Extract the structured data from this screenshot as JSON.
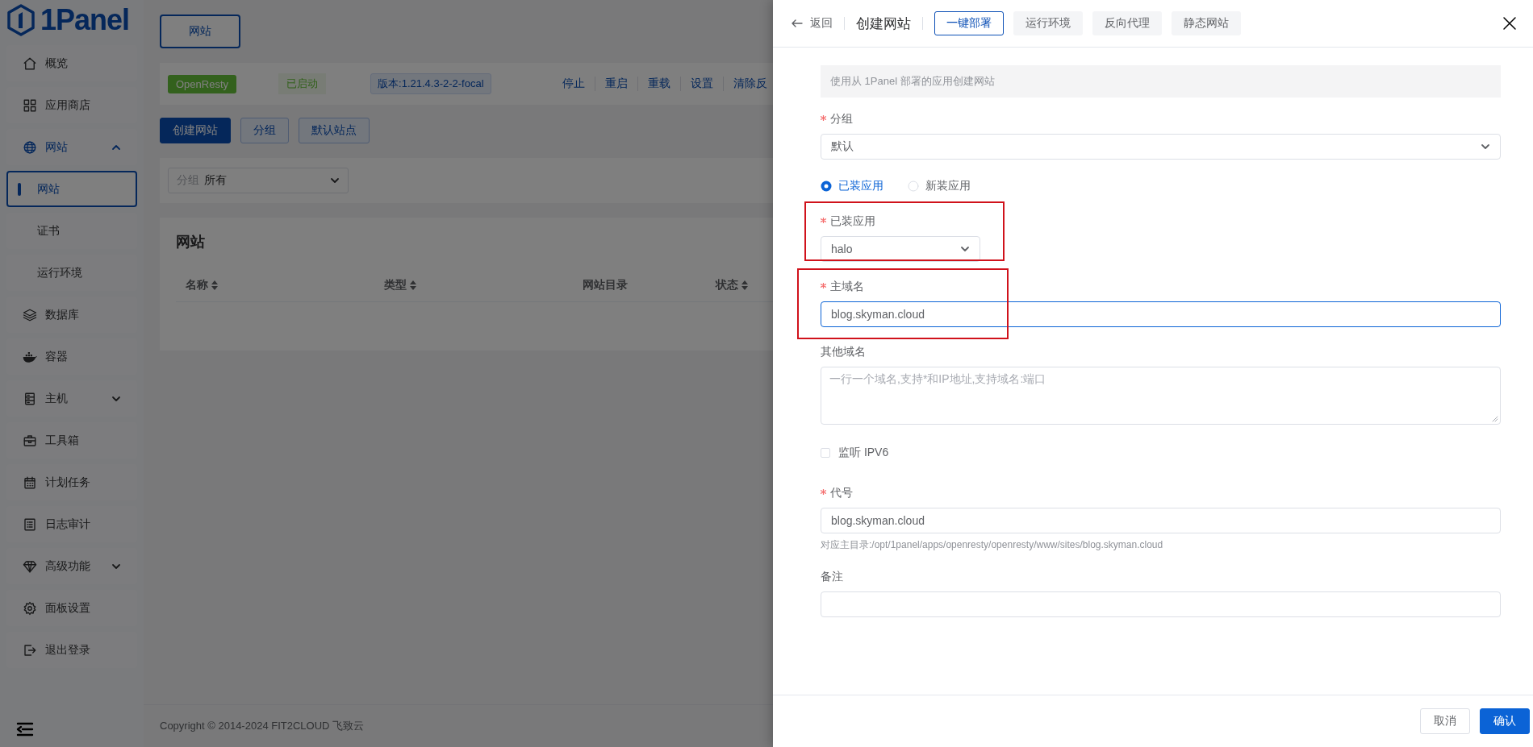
{
  "sidebar": {
    "logo": "1Panel",
    "items": [
      {
        "label": "概览",
        "selected": false
      },
      {
        "label": "应用商店",
        "selected": false
      },
      {
        "label": "网站",
        "selected": false,
        "expanded": true,
        "children": [
          {
            "label": "网站",
            "selected": true
          },
          {
            "label": "证书",
            "selected": false
          },
          {
            "label": "运行环境",
            "selected": false
          }
        ]
      },
      {
        "label": "数据库",
        "selected": false
      },
      {
        "label": "容器",
        "selected": false
      },
      {
        "label": "主机",
        "selected": false,
        "expanded": false
      },
      {
        "label": "工具箱",
        "selected": false
      },
      {
        "label": "计划任务",
        "selected": false
      },
      {
        "label": "日志审计",
        "selected": false
      },
      {
        "label": "高级功能",
        "selected": false,
        "expanded": false
      },
      {
        "label": "面板设置",
        "selected": false
      },
      {
        "label": "退出登录",
        "selected": false
      }
    ]
  },
  "page_tabs": [
    {
      "label": "网站",
      "selected": true
    }
  ],
  "app_status": {
    "app": "OpenResty",
    "state": "已启动",
    "version": "版本:1.21.4.3-2-2-focal",
    "actions": [
      "停止",
      "重启",
      "重载",
      "设置",
      "清除反"
    ]
  },
  "toolbar": [
    {
      "label": "创建网站",
      "primary": true
    },
    {
      "label": "分组",
      "primary": false
    },
    {
      "label": "默认站点",
      "primary": false
    }
  ],
  "filter": {
    "label": "分组",
    "value": "所有"
  },
  "table": {
    "title": "网站",
    "columns": [
      {
        "label": "名称",
        "sortable": true
      },
      {
        "label": "类型",
        "sortable": true
      },
      {
        "label": "网站目录",
        "sortable": false
      },
      {
        "label": "状态",
        "sortable": true
      }
    ]
  },
  "footer": "Copyright © 2014-2024 FIT2CLOUD 飞致云",
  "drawer": {
    "back": "返回",
    "title": "创建网站",
    "tabs": [
      {
        "label": "一键部署",
        "selected": true
      },
      {
        "label": "运行环境",
        "selected": false
      },
      {
        "label": "反向代理",
        "selected": false
      },
      {
        "label": "静态网站",
        "selected": false
      }
    ],
    "alert": "使用从 1Panel 部署的应用创建网站",
    "fields": [
      {
        "kind": "select",
        "label": "分组",
        "required": true,
        "value": "默认"
      },
      {
        "kind": "radio",
        "options": [
          {
            "label": "已装应用",
            "selected": true
          },
          {
            "label": "新装应用",
            "selected": false
          }
        ]
      },
      {
        "kind": "small-select",
        "label": "已装应用",
        "required": true,
        "value": "halo",
        "annotated": true
      },
      {
        "kind": "input",
        "label": "主域名",
        "required": true,
        "value": "blog.skyman.cloud",
        "focused": true,
        "annotated": true
      },
      {
        "kind": "textarea",
        "label": "其他域名",
        "required": false,
        "placeholder": "一行一个域名,支持*和IP地址,支持域名:端口"
      },
      {
        "kind": "checkbox",
        "label": "监听 IPV6",
        "checked": false
      },
      {
        "kind": "input",
        "label": "代号",
        "required": true,
        "value": "blog.skyman.cloud",
        "hint": "对应主目录:/opt/1panel/apps/openresty/openresty/www/sites/blog.skyman.cloud"
      },
      {
        "kind": "input",
        "label": "备注",
        "required": false
      }
    ],
    "buttons": [
      {
        "label": "取消",
        "primary": false
      },
      {
        "label": "确认",
        "primary": true
      }
    ]
  }
}
